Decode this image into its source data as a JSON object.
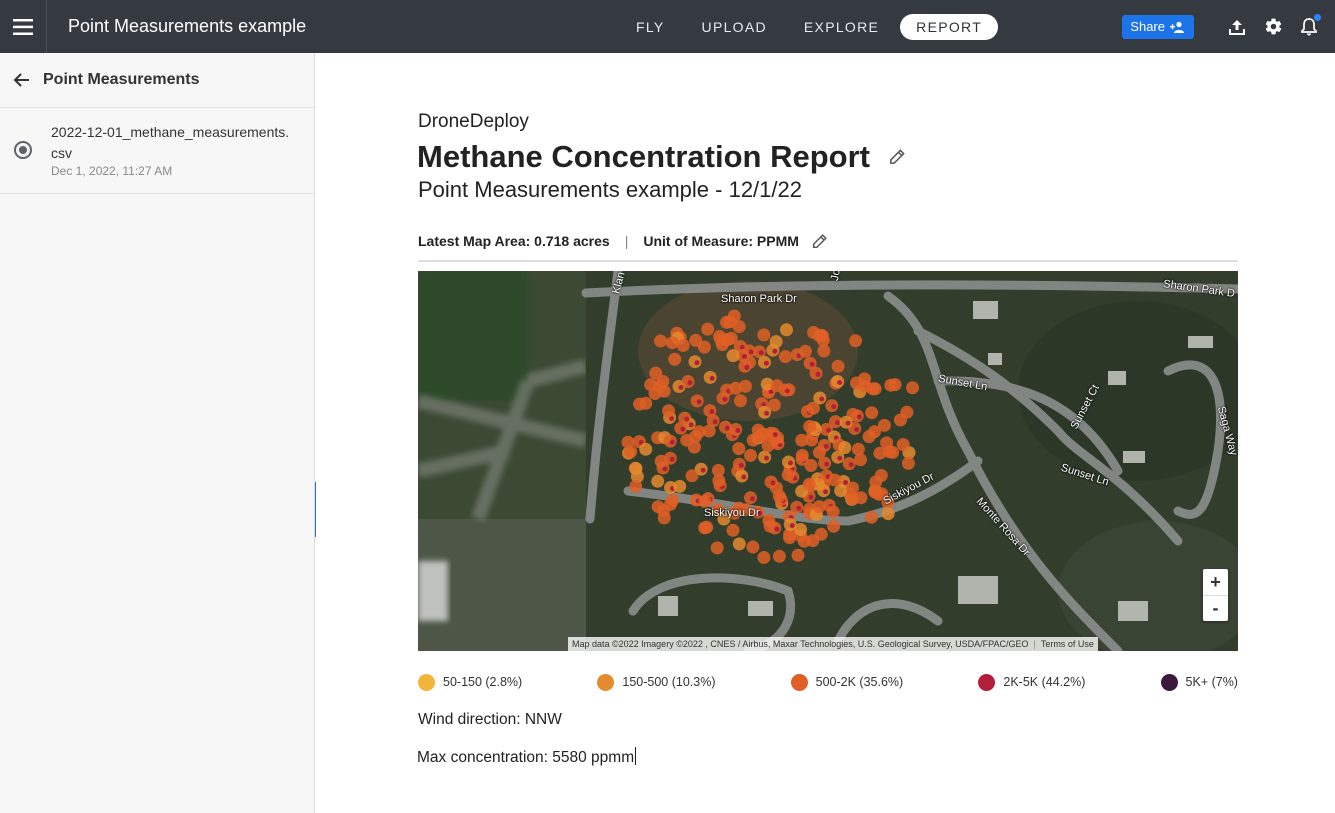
{
  "header": {
    "title": "Point Measurements example",
    "tabs": [
      {
        "label": "FLY",
        "active": false
      },
      {
        "label": "UPLOAD",
        "active": false
      },
      {
        "label": "EXPLORE",
        "active": false
      },
      {
        "label": "REPORT",
        "active": true
      }
    ],
    "share_label": "Share",
    "icons": [
      "menu-icon",
      "add-people-icon",
      "upload-icon",
      "gear-icon",
      "bell-icon"
    ],
    "accent_color": "#1d74e8"
  },
  "sidebar": {
    "title": "Point Measurements",
    "files": [
      {
        "name": "2022-12-01_methane_measurements.csv",
        "date": "Dec 1, 2022, 11:27 AM",
        "selected": true
      }
    ]
  },
  "report": {
    "brand": "DroneDeploy",
    "title": "Methane Concentration Report",
    "subtitle": "Point Measurements example - 12/1/22",
    "map_area": "Latest Map Area: 0.718 acres",
    "separator": "|",
    "unit": "Unit of Measure: PPMM",
    "wind": "Wind direction: NNW",
    "max_concentration": "Max concentration: 5580 ppmm"
  },
  "map": {
    "streets": [
      "Sharon Park Dr",
      "Sharon Park D",
      "Sunset Ln",
      "Sunset Ct",
      "Sunset Ln",
      "Saga Way",
      "Siskiyou Dr",
      "Siskiyou Dr",
      "Monte Rosa Dr",
      "Klan",
      "Jo"
    ],
    "zoom_in": "+",
    "zoom_out": "-",
    "attribution": "Map data ©2022 Imagery ©2022 , CNES / Airbus, Maxar Technologies, U.S. Geological Survey, USDA/FPAC/GEO",
    "terms": "Terms of Use"
  },
  "legend": [
    {
      "label": "50-150 (2.8%)",
      "color": "#f2b43a"
    },
    {
      "label": "150-500 (10.3%)",
      "color": "#e58a2e"
    },
    {
      "label": "500-2K (35.6%)",
      "color": "#df5f26"
    },
    {
      "label": "2K-5K (44.2%)",
      "color": "#b21f3a"
    },
    {
      "label": "5K+ (7%)",
      "color": "#3d1a3c"
    }
  ]
}
